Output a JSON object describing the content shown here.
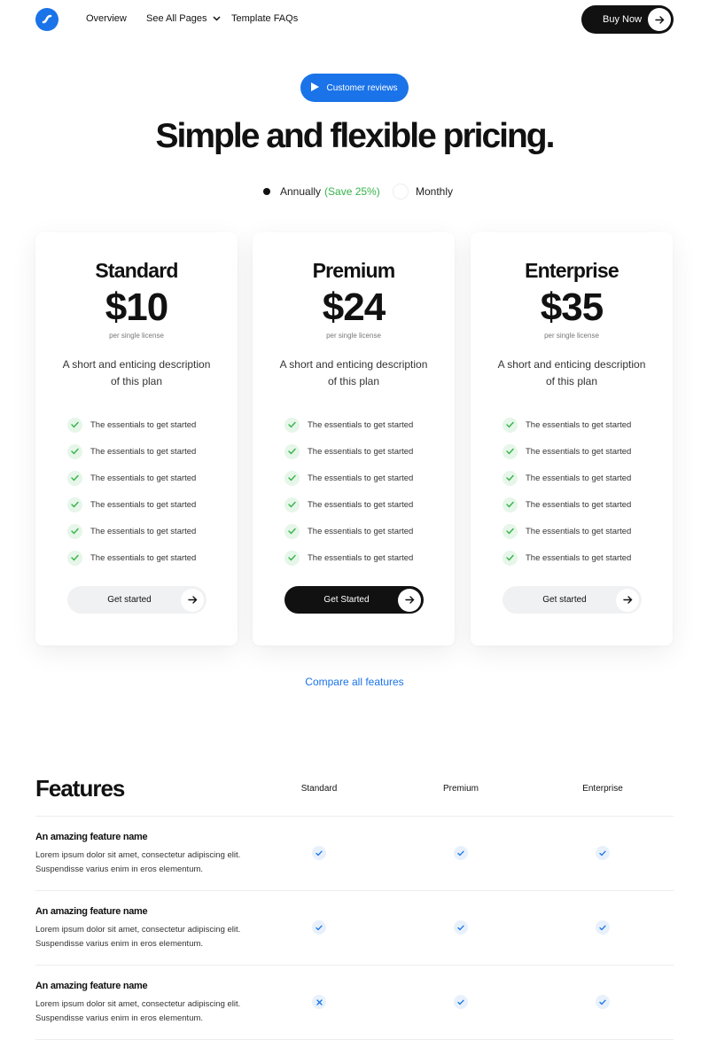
{
  "nav": {
    "links": [
      "Overview",
      "See All Pages",
      "Template FAQs"
    ],
    "buy_label": "Buy Now"
  },
  "hero": {
    "pill_label": "Customer reviews",
    "title": "Simple and flexible pricing.",
    "billing": {
      "annual_label": "Annually",
      "annual_save": "(Save 25%)",
      "monthly_label": "Monthly",
      "selected": "Annually"
    }
  },
  "plans": [
    {
      "name": "Standard",
      "price": "$10",
      "per": "per single license",
      "desc": "A short and enticing description of this plan",
      "features": [
        "The essentials to get started",
        "The essentials to get started",
        "The essentials to get started",
        "The essentials to get started",
        "The essentials to get started",
        "The essentials to get started"
      ],
      "cta": "Get started",
      "highlighted": false
    },
    {
      "name": "Premium",
      "price": "$24",
      "per": "per single license",
      "desc": "A short and enticing description of this plan",
      "features": [
        "The essentials to get started",
        "The essentials to get started",
        "The essentials to get started",
        "The essentials to get started",
        "The essentials to get started",
        "The essentials to get started"
      ],
      "cta": "Get Started",
      "highlighted": true
    },
    {
      "name": "Enterprise",
      "price": "$35",
      "per": "per single license",
      "desc": "A short and enticing description of this plan",
      "features": [
        "The essentials to get started",
        "The essentials to get started",
        "The essentials to get started",
        "The essentials to get started",
        "The essentials to get started",
        "The essentials to get started"
      ],
      "cta": "Get started",
      "highlighted": false
    }
  ],
  "compare_label": "Compare all features",
  "features_table": {
    "title": "Features",
    "columns": [
      "Standard",
      "Premium",
      "Enterprise"
    ],
    "rows": [
      {
        "name": "An amazing feature name",
        "desc": "Lorem ipsum dolor sit amet, consectetur adipiscing elit. Suspendisse varius enim in eros elementum.",
        "values": [
          "check",
          "check",
          "check"
        ]
      },
      {
        "name": "An amazing feature name",
        "desc": "Lorem ipsum dolor sit amet, consectetur adipiscing elit. Suspendisse varius enim in eros elementum.",
        "values": [
          "check",
          "check",
          "check"
        ]
      },
      {
        "name": "An amazing feature name",
        "desc": "Lorem ipsum dolor sit amet, consectetur adipiscing elit. Suspendisse varius enim in eros elementum.",
        "values": [
          "cross",
          "check",
          "check"
        ]
      }
    ]
  },
  "colors": {
    "accent": "#1a73e8",
    "dark": "#111111",
    "save_green": "#35b34a",
    "check_bg": "#e6f6e9",
    "check_green": "#35b34a",
    "mark_bg": "#e8f1fb"
  },
  "icons": {
    "logo": "logo-icon",
    "play": "play-icon",
    "chevron": "chevron-down-icon",
    "arrow": "arrow-right-icon",
    "check": "check-icon",
    "cross": "close-icon"
  }
}
